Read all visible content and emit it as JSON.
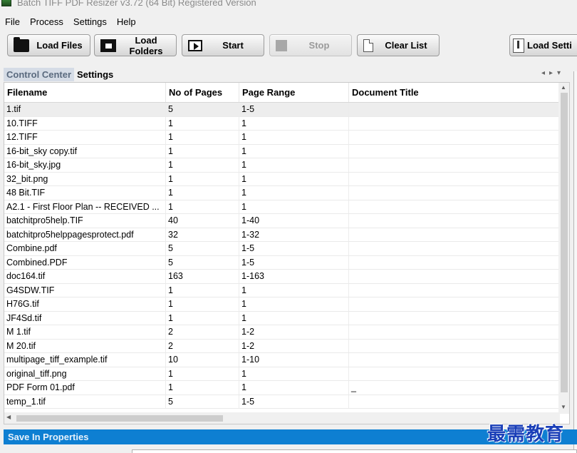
{
  "window": {
    "title": "Batch TIFF PDF Resizer v3.72 (64 Bit)   Registered Version"
  },
  "menu": [
    "File",
    "Process",
    "Settings",
    "Help"
  ],
  "toolbar": {
    "load_files": "Load Files",
    "load_folders": "Load Folders",
    "start": "Start",
    "stop": "Stop",
    "clear_list": "Clear List",
    "load_settings": "Load Setti"
  },
  "tabs": [
    "Control Center",
    "Settings"
  ],
  "table": {
    "columns": [
      "Filename",
      "No of Pages",
      "Page Range",
      "Document Title"
    ],
    "rows": [
      [
        "1.tif",
        "5",
        "1-5",
        ""
      ],
      [
        "10.TIFF",
        "1",
        "1",
        ""
      ],
      [
        "12.TIFF",
        "1",
        "1",
        ""
      ],
      [
        "16-bit_sky copy.tif",
        "1",
        "1",
        ""
      ],
      [
        "16-bit_sky.jpg",
        "1",
        "1",
        ""
      ],
      [
        "32_bit.png",
        "1",
        "1",
        ""
      ],
      [
        "48 Bit.TIF",
        "1",
        "1",
        ""
      ],
      [
        "A2.1 - First Floor Plan -- RECEIVED ...",
        "1",
        "1",
        ""
      ],
      [
        "batchitpro5help.TIF",
        "40",
        "1-40",
        ""
      ],
      [
        "batchitpro5helppagesprotect.pdf",
        "32",
        "1-32",
        ""
      ],
      [
        "Combine.pdf",
        "5",
        "1-5",
        ""
      ],
      [
        "Combined.PDF",
        "5",
        "1-5",
        ""
      ],
      [
        "doc164.tif",
        "163",
        "1-163",
        ""
      ],
      [
        "G4SDW.TIF",
        "1",
        "1",
        ""
      ],
      [
        "H76G.tif",
        "1",
        "1",
        ""
      ],
      [
        "JF4Sd.tif",
        "1",
        "1",
        ""
      ],
      [
        "M 1.tif",
        "2",
        "1-2",
        ""
      ],
      [
        "M 20.tif",
        "2",
        "1-2",
        ""
      ],
      [
        "multipage_tiff_example.tif",
        "10",
        "1-10",
        ""
      ],
      [
        "original_tiff.png",
        "1",
        "1",
        ""
      ],
      [
        "PDF Form 01.pdf",
        "1",
        "1",
        "_"
      ],
      [
        "temp_1.tif",
        "5",
        "1-5",
        ""
      ]
    ]
  },
  "bottom": {
    "save_in_properties": "Save In Properties"
  },
  "watermark": "最需教育"
}
